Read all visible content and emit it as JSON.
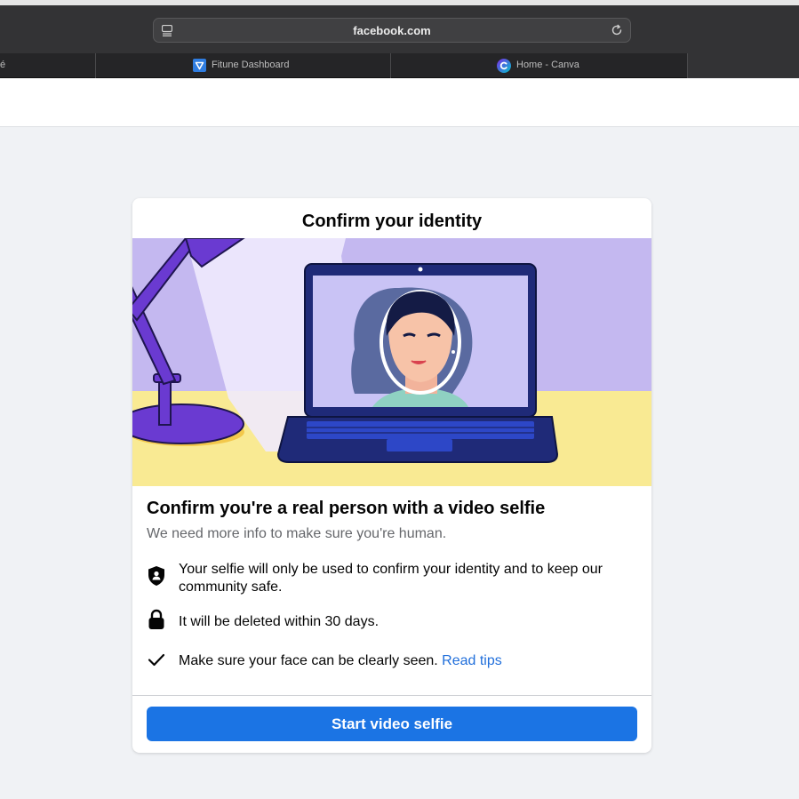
{
  "browser": {
    "url": "facebook.com",
    "tabs": [
      {
        "label": "é",
        "icon": "partial-tab"
      },
      {
        "label": "Fitune Dashboard",
        "icon": "fitune-icon"
      },
      {
        "label": "Home - Canva",
        "icon": "canva-icon"
      }
    ]
  },
  "card": {
    "title": "Confirm your identity",
    "heading": "Confirm you're a real person with a video selfie",
    "subtext": "We need more info to make sure you're human.",
    "items": [
      {
        "icon": "shield-person-icon",
        "text": "Your selfie will only be used to confirm your identity and to keep our community safe."
      },
      {
        "icon": "lock-icon",
        "text": "It will be deleted within 30 days."
      },
      {
        "icon": "checkmark-icon",
        "text": "Make sure your face can be clearly seen.",
        "link": "Read tips"
      }
    ],
    "button_label": "Start video selfie"
  },
  "colors": {
    "accent": "#1b74e4",
    "link": "#216fdb",
    "illustration_bg": "#c4b8f0",
    "desk": "#f9ea93",
    "laptop": "#1f2a78"
  }
}
